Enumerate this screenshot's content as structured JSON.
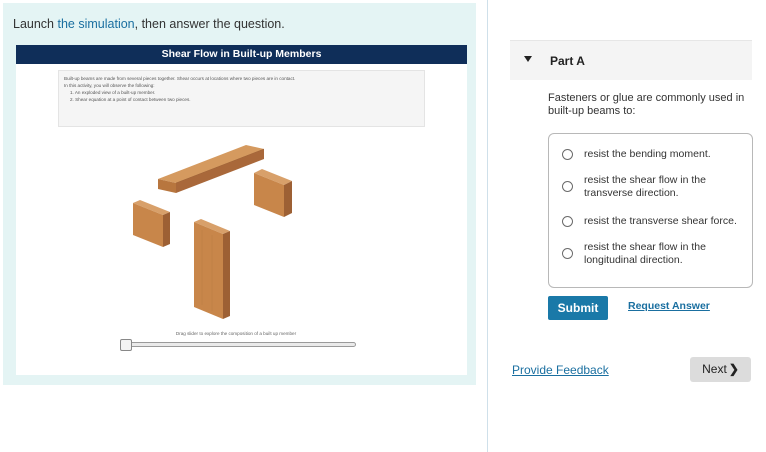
{
  "intro": {
    "prefix": "Launch",
    "link": "the simulation",
    "suffix": ", then answer the question."
  },
  "simulation": {
    "title": "Shear Flow in Built-up Members",
    "description": "Built-up beams are made from several pieces together. Shear occurs at locations where two pieces are in contact.",
    "observe_intro": "In this activity, you will observe the following:",
    "observe_items": [
      "1. An exploded view of a built-up member.",
      "2. Shear equation at a point of contact between two pieces."
    ],
    "slider_caption": "Drag slider to explore the composition of a built up member",
    "slider_value": 0
  },
  "part": {
    "title": "Part A",
    "question": "Fasteners or glue are commonly used in built-up beams to:",
    "choices": [
      "resist the bending moment.",
      "resist the shear flow in the transverse direction.",
      "resist the transverse shear force.",
      "resist the shear flow in the longitudinal direction."
    ],
    "submit_label": "Submit",
    "request_label": "Request Answer"
  },
  "footer": {
    "feedback_label": "Provide Feedback",
    "next_label": "Next",
    "next_chevron": "❯"
  },
  "colors": {
    "header_bg": "#0f2e59",
    "intro_bg": "#e4f4f4",
    "link": "#1a6fa0",
    "submit_bg": "#1a79a8",
    "wood": "#c8864a"
  }
}
